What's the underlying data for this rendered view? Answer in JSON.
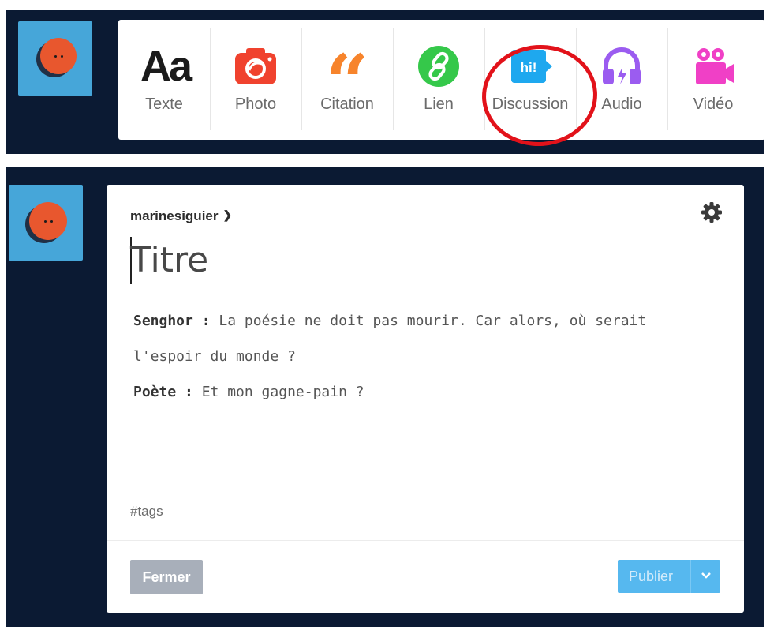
{
  "post_types": [
    {
      "label": "Texte",
      "icon": "text-aa-icon",
      "glyph": "Aa"
    },
    {
      "label": "Photo",
      "icon": "camera-icon",
      "color": "#f0422e"
    },
    {
      "label": "Citation",
      "icon": "quote-icon",
      "glyph": "“",
      "color": "#f7842c"
    },
    {
      "label": "Lien",
      "icon": "link-icon",
      "color": "#35c84a"
    },
    {
      "label": "Discussion",
      "icon": "chat-bubble-icon",
      "glyph": "hi!",
      "color": "#1ea8ef"
    },
    {
      "label": "Audio",
      "icon": "headphones-icon",
      "color": "#9b5cf0"
    },
    {
      "label": "Vidéo",
      "icon": "video-camera-icon",
      "color": "#f040c6"
    }
  ],
  "editor": {
    "blog_name": "marinesiguier",
    "title_placeholder": "Titre",
    "dialogue": [
      {
        "speaker": "Senghor :",
        "line": " La poésie ne doit pas mourir. Car alors, où serait l'espoir du monde ?"
      },
      {
        "speaker": "Poète :",
        "line": " Et mon gagne-pain ?"
      }
    ],
    "tags_placeholder": "#tags",
    "close_label": "Fermer",
    "publish_label": "Publier"
  },
  "colors": {
    "background": "#0b1a33",
    "avatar_bg": "#46a6d9",
    "highlight_ring": "#e2121a",
    "publish": "#56b8ef",
    "close": "#a8afba"
  }
}
